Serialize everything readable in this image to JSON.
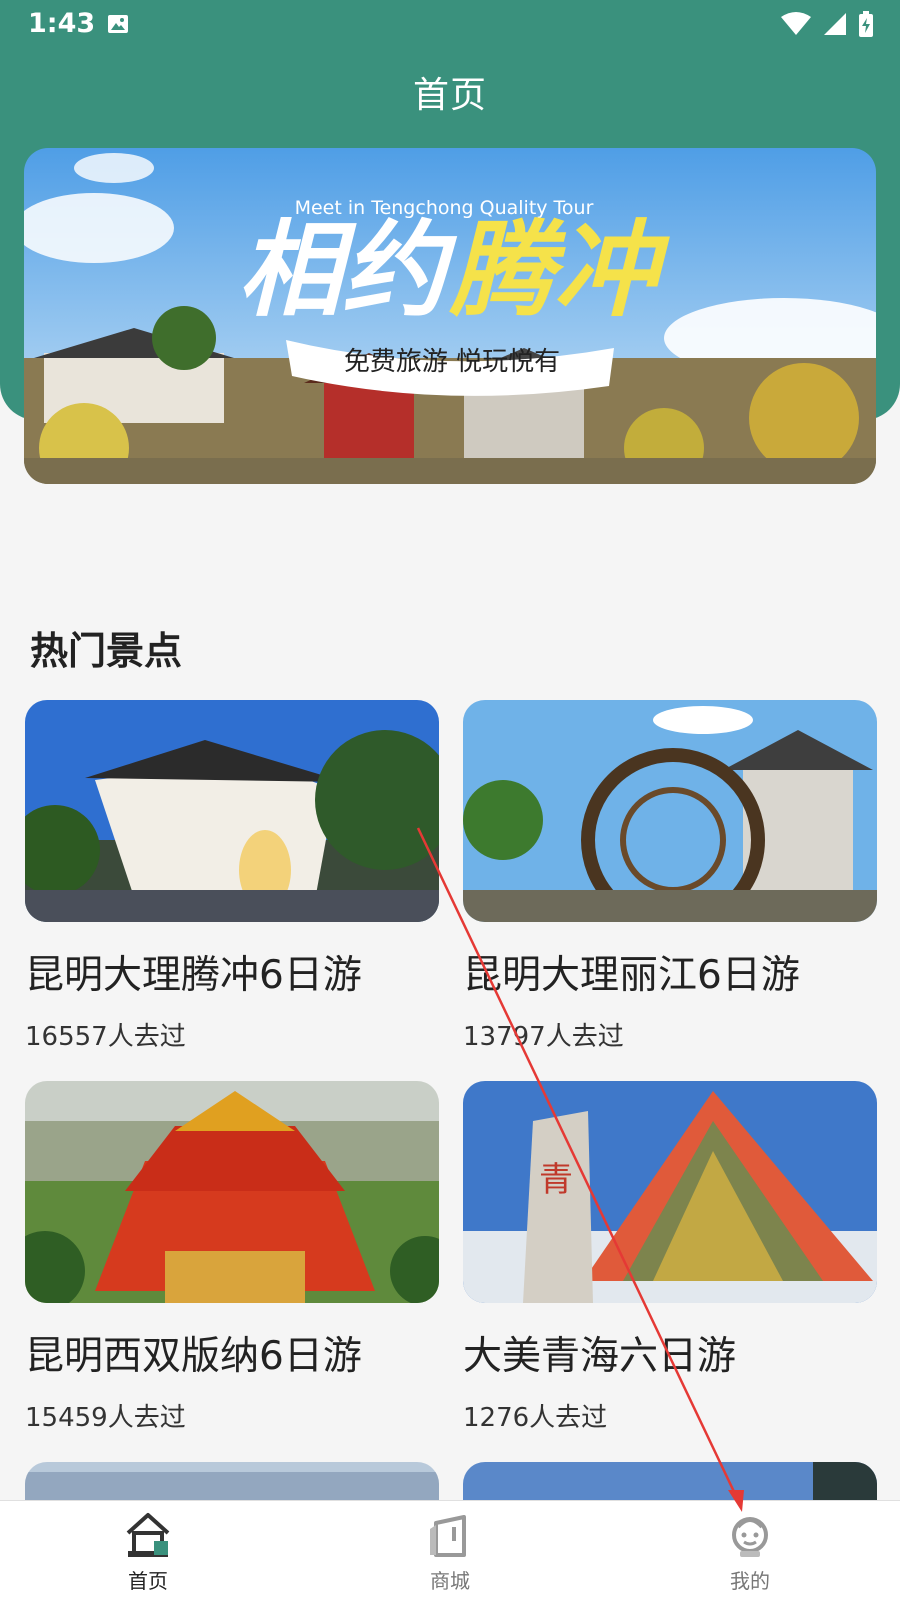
{
  "status": {
    "time": "1:43"
  },
  "header": {
    "title": "首页"
  },
  "banner": {
    "subtitle": "Meet in Tengchong Quality Tour",
    "headline_white": "相约",
    "headline_yellow": "腾冲",
    "ribbon": "免费旅游 悦玩悦有"
  },
  "section": {
    "title": "热门景点"
  },
  "cards": [
    {
      "title": "昆明大理腾冲6日游",
      "count": "16557人去过"
    },
    {
      "title": "昆明大理丽江6日游",
      "count": "13797人去过"
    },
    {
      "title": "昆明西双版纳6日游",
      "count": "15459人去过"
    },
    {
      "title": "大美青海六日游",
      "count": "1276人去过"
    }
  ],
  "tabs": [
    {
      "label": "首页",
      "icon": "home-icon",
      "active": true
    },
    {
      "label": "商城",
      "icon": "mall-icon",
      "active": false
    },
    {
      "label": "我的",
      "icon": "profile-icon",
      "active": false
    }
  ],
  "colors": {
    "primary": "#3a917d",
    "banner_yellow": "#f5e24a",
    "annotation_arrow": "#e53935"
  }
}
